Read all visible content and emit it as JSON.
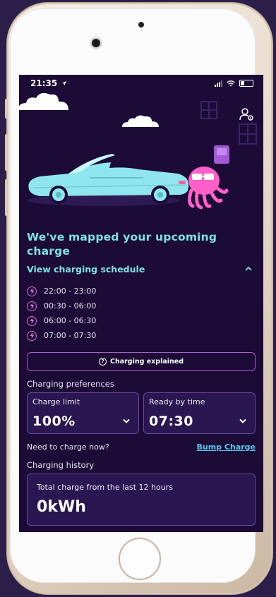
{
  "status_bar": {
    "time": "21:35"
  },
  "headline": "We've mapped your upcoming charge",
  "schedule": {
    "link_label": "View charging schedule",
    "slots": [
      "22:00 - 23:00",
      "00:30 - 06:00",
      "06:00 - 06:30",
      "07:00 - 07:30"
    ]
  },
  "charging_explained_label": "Charging explained",
  "preferences": {
    "label": "Charging preferences",
    "charge_limit": {
      "label": "Charge limit",
      "value": "100%"
    },
    "ready_by": {
      "label": "Ready by time",
      "value": "07:30"
    }
  },
  "charge_now": {
    "prompt": "Need to charge now?",
    "bump_label": "Bump Charge"
  },
  "history": {
    "label": "Charging history",
    "card_label": "Total charge from the last 12 hours",
    "value": "0kWh"
  },
  "colors": {
    "background": "#1b0b36",
    "accent_teal": "#7ee0e6",
    "accent_pink": "#d96fcf",
    "link_blue": "#5bc7e8",
    "card": "#2a1650"
  },
  "icons": [
    "location-arrow-icon",
    "signal-icon",
    "wifi-icon",
    "battery-icon",
    "profile-settings-icon",
    "chevron-up-icon",
    "bolt-icon",
    "info-icon",
    "chevron-down-icon"
  ]
}
